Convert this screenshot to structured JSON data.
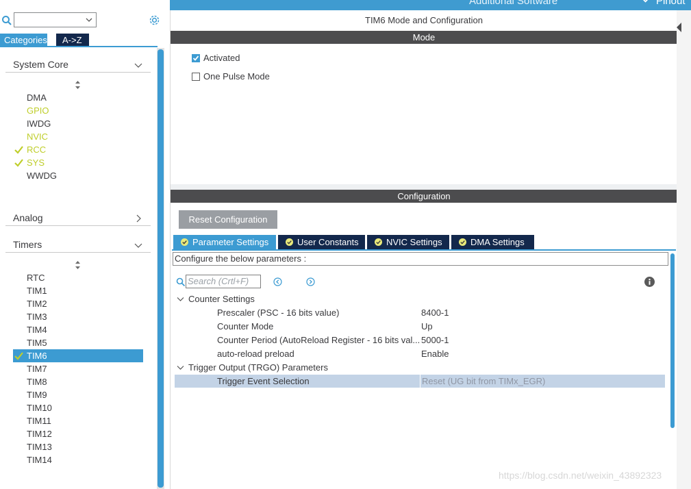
{
  "topbar": {
    "menu_item_1": "Additional Software",
    "menu_item_2": "Pinout"
  },
  "left_panel": {
    "search": {
      "value": ""
    },
    "tabs": [
      {
        "label": "Categories",
        "active": true
      },
      {
        "label": "A->Z",
        "active": false
      }
    ],
    "sections": [
      {
        "label": "System Core",
        "expanded": true,
        "items": [
          {
            "label": "DMA",
            "color": "normal",
            "checked": false
          },
          {
            "label": "GPIO",
            "color": "yellow",
            "checked": false
          },
          {
            "label": "IWDG",
            "color": "normal",
            "checked": false
          },
          {
            "label": "NVIC",
            "color": "yellow",
            "checked": false
          },
          {
            "label": "RCC",
            "color": "yellow",
            "checked": true
          },
          {
            "label": "SYS",
            "color": "yellow",
            "checked": true
          },
          {
            "label": "WWDG",
            "color": "normal",
            "checked": false
          }
        ]
      },
      {
        "label": "Analog",
        "expanded": false,
        "items": []
      },
      {
        "label": "Timers",
        "expanded": true,
        "items": [
          {
            "label": "RTC",
            "checked": false
          },
          {
            "label": "TIM1",
            "checked": false
          },
          {
            "label": "TIM2",
            "checked": false
          },
          {
            "label": "TIM3",
            "checked": false
          },
          {
            "label": "TIM4",
            "checked": false
          },
          {
            "label": "TIM5",
            "checked": false
          },
          {
            "label": "TIM6",
            "checked": true,
            "selected": true
          },
          {
            "label": "TIM7",
            "checked": false
          },
          {
            "label": "TIM8",
            "checked": false
          },
          {
            "label": "TIM9",
            "checked": false
          },
          {
            "label": "TIM10",
            "checked": false
          },
          {
            "label": "TIM11",
            "checked": false
          },
          {
            "label": "TIM12",
            "checked": false
          },
          {
            "label": "TIM13",
            "checked": false
          },
          {
            "label": "TIM14",
            "checked": false
          }
        ]
      }
    ]
  },
  "main": {
    "title": "TIM6 Mode and Configuration",
    "mode_bar": "Mode",
    "mode_options": [
      {
        "label": "Activated",
        "checked": true
      },
      {
        "label": "One Pulse Mode",
        "checked": false
      }
    ],
    "config_bar": "Configuration",
    "reset_button": "Reset Configuration",
    "tabs": [
      {
        "label": "Parameter Settings",
        "active": true
      },
      {
        "label": "User Constants",
        "active": false
      },
      {
        "label": "NVIC Settings",
        "active": false
      },
      {
        "label": "DMA Settings",
        "active": false
      }
    ],
    "configure_hint": "Configure the below parameters :",
    "search_placeholder": "Search (Crtl+F)",
    "groups": [
      {
        "label": "Counter Settings",
        "params": [
          {
            "name": "Prescaler (PSC - 16 bits value)",
            "value": "8400-1"
          },
          {
            "name": "Counter Mode",
            "value": "Up"
          },
          {
            "name": "Counter Period (AutoReload Register - 16 bits val...",
            "value": "5000-1"
          },
          {
            "name": "auto-reload preload",
            "value": "Enable"
          }
        ]
      },
      {
        "label": "Trigger Output (TRGO) Parameters",
        "params": [
          {
            "name": "Trigger Event Selection",
            "value": "Reset (UG bit from TIMx_EGR)",
            "selected": true
          }
        ]
      }
    ]
  },
  "watermark": "https://blog.csdn.net/weixin_43892323",
  "colors": {
    "accent": "#3c9bd2",
    "dark_navy": "#13284c",
    "bar_grey": "#4c4c4e",
    "peripheral_yellow": "#bfce2a",
    "selected_row": "#c3d3e6"
  }
}
